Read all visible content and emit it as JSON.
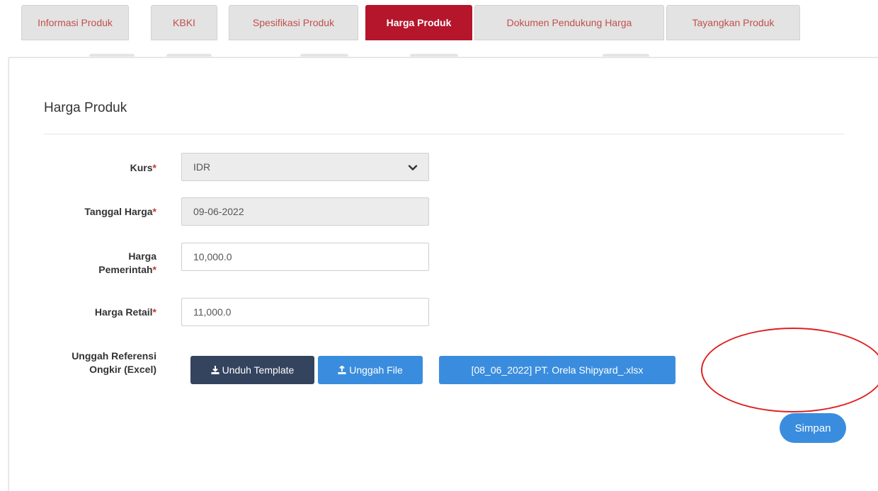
{
  "tabs": [
    {
      "label": "Informasi Produk",
      "active": false
    },
    {
      "label": "KBKI",
      "active": false
    },
    {
      "label": "Spesifikasi Produk",
      "active": false
    },
    {
      "label": "Harga Produk",
      "active": true
    },
    {
      "label": "Dokumen Pendukung Harga",
      "active": false
    },
    {
      "label": "Tayangkan Produk",
      "active": false
    }
  ],
  "section": {
    "title": "Harga Produk"
  },
  "form": {
    "kurs": {
      "label": "Kurs",
      "required_mark": "*",
      "value": "IDR",
      "icon": "chevron-down-icon"
    },
    "tanggal_harga": {
      "label": "Tanggal Harga",
      "required_mark": "*",
      "value": "09-06-2022"
    },
    "harga_pemerintah": {
      "label_line1": "Harga",
      "label_line2": "Pemerintah",
      "required_mark": "*",
      "value": "10,000.0"
    },
    "harga_retail": {
      "label": "Harga Retail",
      "required_mark": "*",
      "value": "11,000.0"
    },
    "unggah_referensi": {
      "label_line1": "Unggah Referensi",
      "label_line2": "Ongkir (Excel)"
    }
  },
  "buttons": {
    "unduh_template": {
      "label": "Unduh Template",
      "icon": "download-icon"
    },
    "unggah_file": {
      "label": "Unggah File",
      "icon": "upload-icon"
    },
    "uploaded_file": {
      "label": "[08_06_2022] PT. Orela Shipyard_.xlsx"
    },
    "simpan": {
      "label": "Simpan"
    }
  },
  "colors": {
    "active_tab": "#b5162b",
    "tab_text": "#c0504d",
    "primary_blue": "#3a8dde",
    "dark_button": "#34435e",
    "annotation": "#e02020"
  }
}
